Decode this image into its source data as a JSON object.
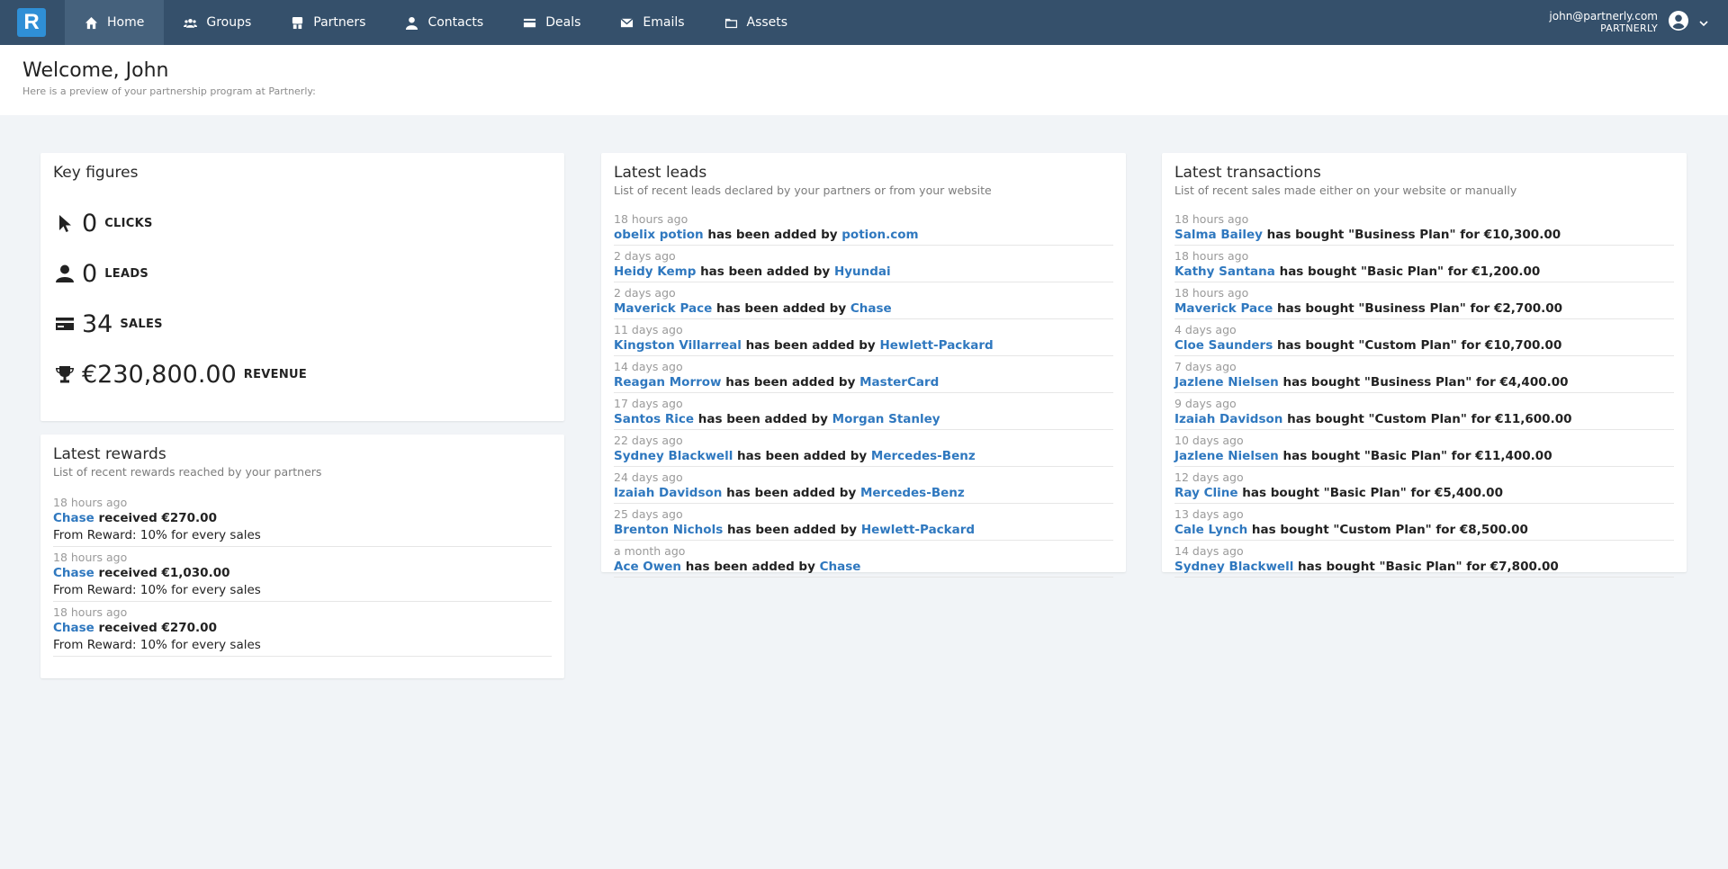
{
  "app": {
    "logo_letter": "R",
    "brand_color": "#2f8fd6",
    "nav_bg": "#35506b"
  },
  "nav": {
    "items": [
      {
        "label": "Home",
        "icon": "home-icon",
        "active": true
      },
      {
        "label": "Groups",
        "icon": "groups-icon"
      },
      {
        "label": "Partners",
        "icon": "partners-icon"
      },
      {
        "label": "Contacts",
        "icon": "contact-icon"
      },
      {
        "label": "Deals",
        "icon": "card-icon"
      },
      {
        "label": "Emails",
        "icon": "envelope-icon"
      },
      {
        "label": "Assets",
        "icon": "folder-icon"
      }
    ]
  },
  "user": {
    "email": "john@partnerly.com",
    "org": "PARTNERLY"
  },
  "welcome": {
    "title": "Welcome, John",
    "subtitle": "Here is a preview of your partnership program at Partnerly:"
  },
  "key_figures": {
    "title": "Key figures",
    "items": [
      {
        "value": "0",
        "label": "CLICKS",
        "icon": "cursor-icon"
      },
      {
        "value": "0",
        "label": "LEADS",
        "icon": "person-icon"
      },
      {
        "value": "34",
        "label": "SALES",
        "icon": "credit-card-icon"
      },
      {
        "value": "€230,800.00",
        "label": "REVENUE",
        "icon": "trophy-icon"
      }
    ]
  },
  "rewards": {
    "title": "Latest rewards",
    "subtitle": "List of recent rewards reached by your partners",
    "items": [
      {
        "time": "18 hours ago",
        "partner": "Chase",
        "verb": "received",
        "amount": "€270.00",
        "detail": "From Reward: 10% for every sales"
      },
      {
        "time": "18 hours ago",
        "partner": "Chase",
        "verb": "received",
        "amount": "€1,030.00",
        "detail": "From Reward: 10% for every sales"
      },
      {
        "time": "18 hours ago",
        "partner": "Chase",
        "verb": "received",
        "amount": "€270.00",
        "detail": "From Reward: 10% for every sales"
      }
    ]
  },
  "leads": {
    "title": "Latest leads",
    "subtitle": "List of recent leads declared by your partners or from your website",
    "connector": "has been added by",
    "items": [
      {
        "time": "18 hours ago",
        "name": "obelix potion",
        "source": "potion.com"
      },
      {
        "time": "2 days ago",
        "name": "Heidy Kemp",
        "source": "Hyundai"
      },
      {
        "time": "2 days ago",
        "name": "Maverick Pace",
        "source": "Chase"
      },
      {
        "time": "11 days ago",
        "name": "Kingston Villarreal",
        "source": "Hewlett-Packard"
      },
      {
        "time": "14 days ago",
        "name": "Reagan Morrow",
        "source": "MasterCard"
      },
      {
        "time": "17 days ago",
        "name": "Santos Rice",
        "source": "Morgan Stanley"
      },
      {
        "time": "22 days ago",
        "name": "Sydney Blackwell",
        "source": "Mercedes-Benz"
      },
      {
        "time": "24 days ago",
        "name": "Izaiah Davidson",
        "source": "Mercedes-Benz"
      },
      {
        "time": "25 days ago",
        "name": "Brenton Nichols",
        "source": "Hewlett-Packard"
      },
      {
        "time": "a month ago",
        "name": "Ace Owen",
        "source": "Chase"
      }
    ]
  },
  "transactions": {
    "title": "Latest transactions",
    "subtitle": "List of recent sales made either on your website or manually",
    "items": [
      {
        "time": "18 hours ago",
        "name": "Salma Bailey",
        "text": "has bought \"Business Plan\" for €10,300.00"
      },
      {
        "time": "18 hours ago",
        "name": "Kathy Santana",
        "text": "has bought \"Basic Plan\" for €1,200.00"
      },
      {
        "time": "18 hours ago",
        "name": "Maverick Pace",
        "text": "has bought \"Business Plan\" for €2,700.00"
      },
      {
        "time": "4 days ago",
        "name": "Cloe Saunders",
        "text": "has bought \"Custom Plan\" for €10,700.00"
      },
      {
        "time": "7 days ago",
        "name": "Jazlene Nielsen",
        "text": "has bought \"Business Plan\" for €4,400.00"
      },
      {
        "time": "9 days ago",
        "name": "Izaiah Davidson",
        "text": "has bought \"Custom Plan\" for €11,600.00"
      },
      {
        "time": "10 days ago",
        "name": "Jazlene Nielsen",
        "text": "has bought \"Basic Plan\" for €11,400.00"
      },
      {
        "time": "12 days ago",
        "name": "Ray Cline",
        "text": "has bought \"Basic Plan\" for €5,400.00"
      },
      {
        "time": "13 days ago",
        "name": "Cale Lynch",
        "text": "has bought \"Custom Plan\" for €8,500.00"
      },
      {
        "time": "14 days ago",
        "name": "Sydney Blackwell",
        "text": "has bought \"Basic Plan\" for €7,800.00"
      }
    ]
  }
}
